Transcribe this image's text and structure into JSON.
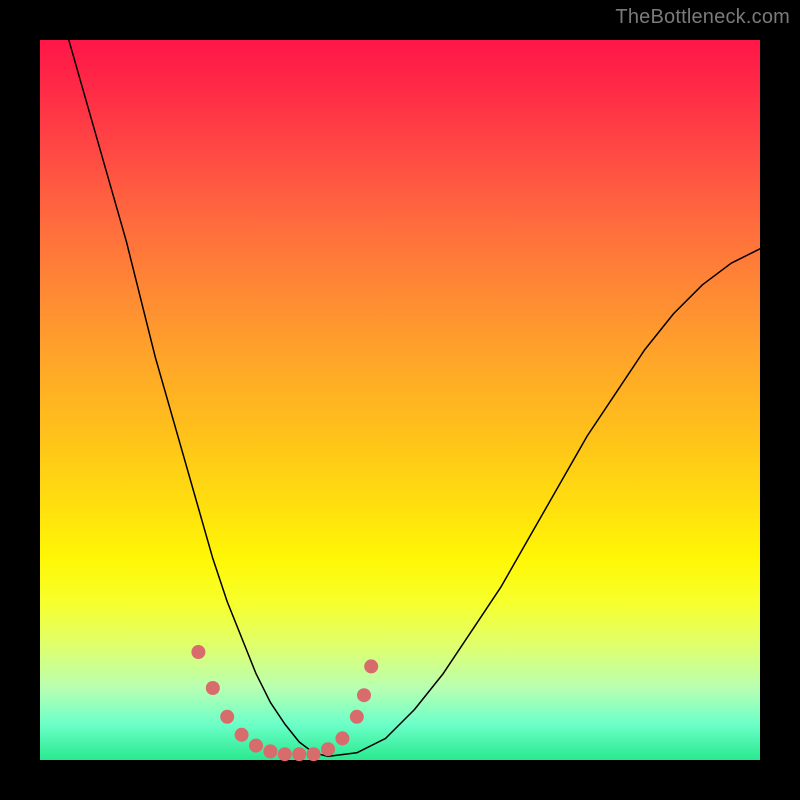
{
  "watermark": "TheBottleneck.com",
  "chart_data": {
    "type": "line",
    "title": "",
    "xlabel": "",
    "ylabel": "",
    "xlim": [
      0,
      100
    ],
    "ylim": [
      0,
      100
    ],
    "grid": false,
    "legend": false,
    "series": [
      {
        "name": "bottleneck-curve",
        "x": [
          4,
          6,
          8,
          10,
          12,
          14,
          16,
          18,
          20,
          22,
          24,
          26,
          28,
          30,
          32,
          34,
          36,
          38,
          40,
          44,
          48,
          52,
          56,
          60,
          64,
          68,
          72,
          76,
          80,
          84,
          88,
          92,
          96,
          100
        ],
        "y": [
          100,
          93,
          86,
          79,
          72,
          64,
          56,
          49,
          42,
          35,
          28,
          22,
          17,
          12,
          8,
          5,
          2.5,
          1,
          0.5,
          1,
          3,
          7,
          12,
          18,
          24,
          31,
          38,
          45,
          51,
          57,
          62,
          66,
          69,
          71
        ]
      }
    ],
    "markers": {
      "name": "highlight-points",
      "color": "#d86b6b",
      "x": [
        22,
        24,
        26,
        28,
        30,
        32,
        34,
        36,
        38,
        40,
        42,
        44,
        45,
        46
      ],
      "y": [
        15,
        10,
        6,
        3.5,
        2,
        1.2,
        0.8,
        0.8,
        0.8,
        1.5,
        3,
        6,
        9,
        13
      ]
    }
  },
  "colors": {
    "background": "#000000",
    "gradient_top": "#ff1648",
    "gradient_bottom": "#29e98f",
    "curve": "#000000",
    "marker": "#d86b6b",
    "watermark": "#7a7a7a"
  }
}
